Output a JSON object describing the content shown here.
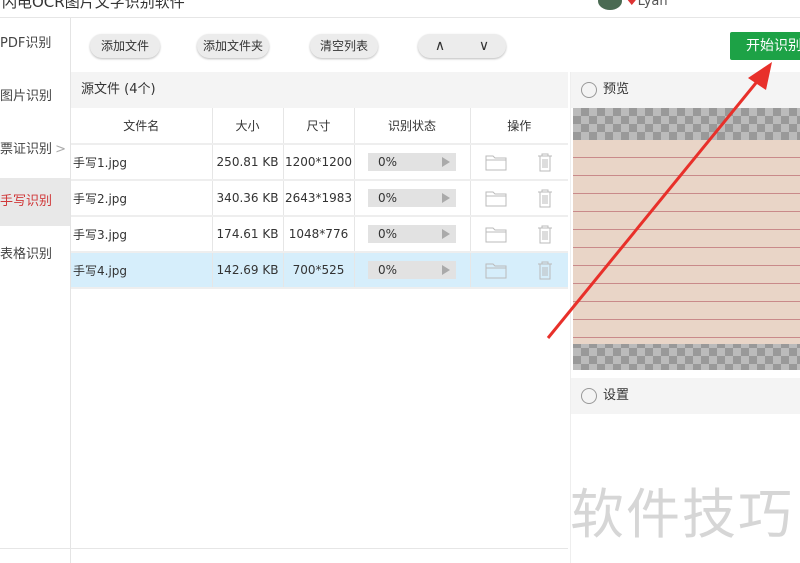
{
  "app": {
    "title": "闪电OCR图片文字识别软件",
    "user": "Lyan"
  },
  "sidebar": {
    "items": [
      {
        "label": "PDF识别"
      },
      {
        "label": "图片识别"
      },
      {
        "label": "票证识别"
      },
      {
        "label": "手写识别"
      },
      {
        "label": "表格识别"
      }
    ],
    "active": "手写识别"
  },
  "toolbar": {
    "add_file": "添加文件",
    "add_folder": "添加文件夹",
    "clear_list": "清空列表",
    "up": "∧",
    "down": "∨",
    "start": "开始识别"
  },
  "files": {
    "header": "源文件 (4个)",
    "columns": [
      "文件名",
      "大小",
      "尺寸",
      "识别状态",
      "操作"
    ],
    "rows": [
      {
        "name": "手写1.jpg",
        "size": "250.81 KB",
        "dim": "1200*1200",
        "status": "0%"
      },
      {
        "name": "手写2.jpg",
        "size": "340.36 KB",
        "dim": "2643*1983",
        "status": "0%"
      },
      {
        "name": "手写3.jpg",
        "size": "174.61 KB",
        "dim": "1048*776",
        "status": "0%"
      },
      {
        "name": "手写4.jpg",
        "size": "142.69 KB",
        "dim": "700*525",
        "status": "0%"
      }
    ]
  },
  "right": {
    "preview": "预览",
    "settings": "设置"
  },
  "watermark": "软件技巧",
  "colors": {
    "accent": "#1da246",
    "active": "#d0393a",
    "selected_row": "#d6eefb"
  }
}
